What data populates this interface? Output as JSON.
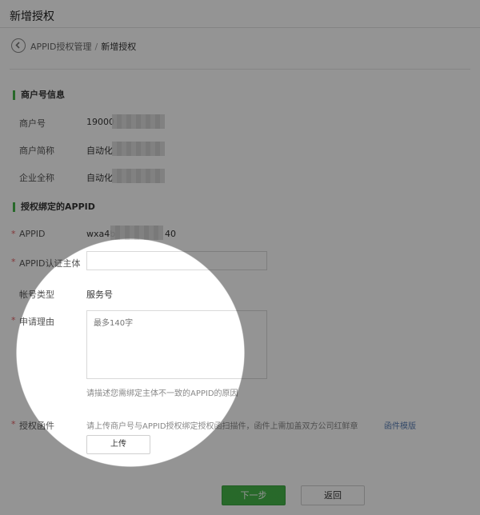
{
  "header": {
    "title": "新增授权"
  },
  "breadcrumb": {
    "parent": "APPID授权管理",
    "separator": "/",
    "current": "新增授权"
  },
  "merchant_section": {
    "title": "商户号信息",
    "merchant_no_label": "商户号",
    "merchant_no_value": "19000",
    "short_name_label": "商户简称",
    "short_name_value": "自动化",
    "full_name_label": "企业全称",
    "full_name_value": "自动化"
  },
  "appid_section": {
    "title": "授权绑定的APPID",
    "appid_label": "APPID",
    "appid_value_prefix": "wxa4b",
    "appid_value_suffix": "40",
    "entity_label": "APPID认证主体",
    "entity_value": "",
    "account_type_label": "帐号类型",
    "account_type_value": "服务号",
    "reason_label": "申请理由",
    "reason_placeholder": "最多140字",
    "reason_hint": "请描述您需绑定主体不一致的APPID的原因",
    "attachment_label": "授权函件",
    "attachment_hint": "请上传商户号与APPID授权绑定授权函扫描件，函件上需加盖双方公司红鲜章",
    "template_link": "函件模版",
    "upload_label": "上传"
  },
  "actions": {
    "next_label": "下一步",
    "back_label": "返回"
  },
  "colors": {
    "accent": "#44b549",
    "required": "#e15f63",
    "link": "#5b7fb5"
  }
}
